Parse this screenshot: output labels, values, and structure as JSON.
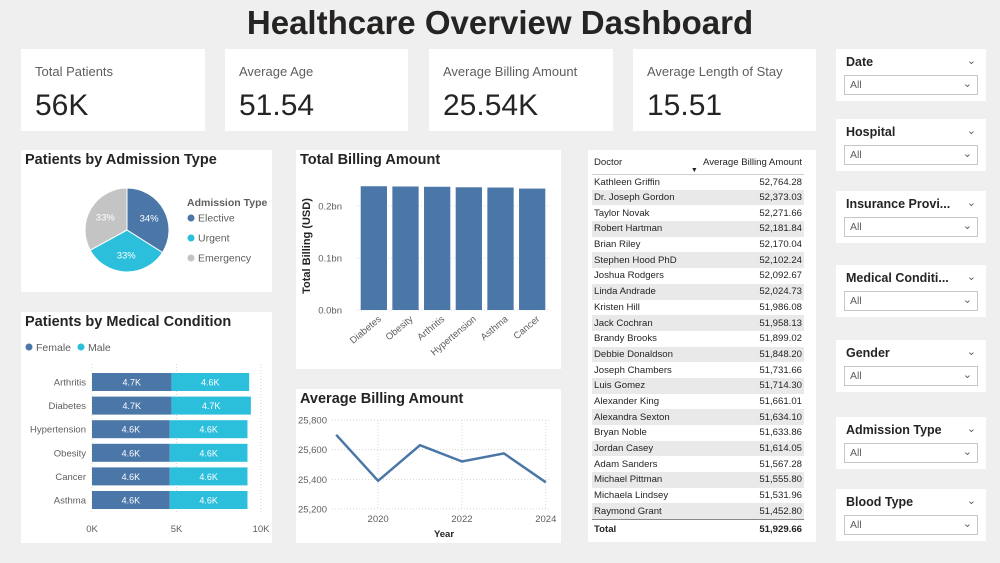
{
  "header": {
    "title": "Healthcare Overview Dashboard"
  },
  "kpis": [
    {
      "label": "Total Patients",
      "value": "56K"
    },
    {
      "label": "Average Age",
      "value": "51.54"
    },
    {
      "label": "Average Billing Amount",
      "value": "25.54K"
    },
    {
      "label": "Average Length of Stay",
      "value": "15.51"
    }
  ],
  "admission_pie": {
    "title": "Patients by Admission Type",
    "legend_title": "Admission Type",
    "slices": [
      {
        "name": "Elective",
        "value": 34,
        "label": "34%",
        "color": "#4a76a8"
      },
      {
        "name": "Urgent",
        "value": 33,
        "label": "33%",
        "color": "#2bbfdc"
      },
      {
        "name": "Emergency",
        "value": 33,
        "label": "33%",
        "color": "#c4c4c4"
      }
    ]
  },
  "medical_condition": {
    "title": "Patients by Medical Condition",
    "legend": [
      {
        "name": "Female",
        "color": "#4a76a8"
      },
      {
        "name": "Male",
        "color": "#2bbfdc"
      }
    ],
    "rows": [
      {
        "condition": "Arthritis",
        "female": 4700,
        "male": 4600,
        "female_label": "4.7K",
        "male_label": "4.6K"
      },
      {
        "condition": "Diabetes",
        "female": 4700,
        "male": 4700,
        "female_label": "4.7K",
        "male_label": "4.7K"
      },
      {
        "condition": "Hypertension",
        "female": 4600,
        "male": 4600,
        "female_label": "4.6K",
        "male_label": "4.6K"
      },
      {
        "condition": "Obesity",
        "female": 4600,
        "male": 4600,
        "female_label": "4.6K",
        "male_label": "4.6K"
      },
      {
        "condition": "Cancer",
        "female": 4600,
        "male": 4600,
        "female_label": "4.6K",
        "male_label": "4.6K"
      },
      {
        "condition": "Asthma",
        "female": 4600,
        "male": 4600,
        "female_label": "4.6K",
        "male_label": "4.6K"
      }
    ],
    "x_ticks": [
      {
        "value": 0,
        "label": "0K"
      },
      {
        "value": 5000,
        "label": "5K"
      },
      {
        "value": 10000,
        "label": "10K"
      }
    ],
    "xmax": 10000
  },
  "total_billing": {
    "title": "Total Billing Amount",
    "ylabel": "Total Billing (USD)",
    "categories": [
      "Diabetes",
      "Obesity",
      "Arthritis",
      "Hypertension",
      "Asthma",
      "Cancer"
    ],
    "values": [
      0.238,
      0.2375,
      0.237,
      0.236,
      0.2355,
      0.2335
    ],
    "y_ticks": [
      {
        "value": 0,
        "label": "0.0bn"
      },
      {
        "value": 0.1,
        "label": "0.1bn"
      },
      {
        "value": 0.2,
        "label": "0.2bn"
      }
    ],
    "ymax": 0.25
  },
  "avg_billing": {
    "title": "Average Billing Amount",
    "xlabel": "Year",
    "x": [
      2019,
      2020,
      2021,
      2022,
      2023,
      2024
    ],
    "values": [
      25700,
      25390,
      25630,
      25520,
      25575,
      25380
    ],
    "y_ticks": [
      {
        "value": 25200,
        "label": "25,200"
      },
      {
        "value": 25400,
        "label": "25,400"
      },
      {
        "value": 25600,
        "label": "25,600"
      },
      {
        "value": 25800,
        "label": "25,800"
      }
    ],
    "x_ticks": [
      {
        "value": 2020,
        "label": "2020"
      },
      {
        "value": 2022,
        "label": "2022"
      },
      {
        "value": 2024,
        "label": "2024"
      }
    ],
    "ylim": [
      25200,
      25800
    ],
    "xlim": [
      2018.9,
      2024.1
    ],
    "color": "#4a76a8"
  },
  "doctor_table": {
    "col1": "Doctor",
    "col2": "Average Billing Amount",
    "rows": [
      {
        "doctor": "Kathleen Griffin",
        "amount": "52,764.28"
      },
      {
        "doctor": "Dr. Joseph Gordon",
        "amount": "52,373.03"
      },
      {
        "doctor": "Taylor Novak",
        "amount": "52,271.66"
      },
      {
        "doctor": "Robert Hartman",
        "amount": "52,181.84"
      },
      {
        "doctor": "Brian Riley",
        "amount": "52,170.04"
      },
      {
        "doctor": "Stephen Hood PhD",
        "amount": "52,102.24"
      },
      {
        "doctor": "Joshua Rodgers",
        "amount": "52,092.67"
      },
      {
        "doctor": "Linda Andrade",
        "amount": "52,024.73"
      },
      {
        "doctor": "Kristen Hill",
        "amount": "51,986.08"
      },
      {
        "doctor": "Jack Cochran",
        "amount": "51,958.13"
      },
      {
        "doctor": "Brandy Brooks",
        "amount": "51,899.02"
      },
      {
        "doctor": "Debbie Donaldson",
        "amount": "51,848.20"
      },
      {
        "doctor": "Joseph Chambers",
        "amount": "51,731.66"
      },
      {
        "doctor": "Luis Gomez",
        "amount": "51,714.30"
      },
      {
        "doctor": "Alexander King",
        "amount": "51,661.01"
      },
      {
        "doctor": "Alexandra Sexton",
        "amount": "51,634.10"
      },
      {
        "doctor": "Bryan Noble",
        "amount": "51,633.86"
      },
      {
        "doctor": "Jordan Casey",
        "amount": "51,614.05"
      },
      {
        "doctor": "Adam Sanders",
        "amount": "51,567.28"
      },
      {
        "doctor": "Michael Pittman",
        "amount": "51,555.80"
      },
      {
        "doctor": "Michaela Lindsey",
        "amount": "51,531.96"
      },
      {
        "doctor": "Raymond Grant",
        "amount": "51,452.80"
      }
    ],
    "total_label": "Total",
    "total_value": "51,929.66"
  },
  "slicers": [
    {
      "title": "Date",
      "value": "All"
    },
    {
      "title": "Hospital",
      "value": "All"
    },
    {
      "title": "Insurance Provi...",
      "value": "All"
    },
    {
      "title": "Medical Conditi...",
      "value": "All"
    },
    {
      "title": "Gender",
      "value": "All"
    },
    {
      "title": "Admission Type",
      "value": "All"
    },
    {
      "title": "Blood Type",
      "value": "All"
    }
  ],
  "icons": {
    "chevron": "chevron-down-icon",
    "dropdown": "dropdown-caret-icon",
    "sort": "sort-desc-icon"
  }
}
